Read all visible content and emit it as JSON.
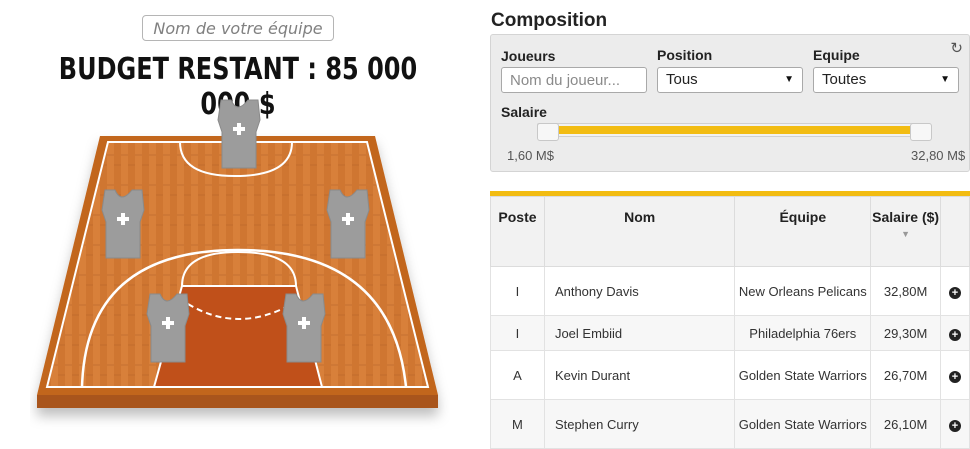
{
  "left": {
    "team_input_placeholder": "Nom de votre équipe",
    "budget_text": "BUDGET RESTANT : 85 000 000 $",
    "court_colors": {
      "wood": "#d8803a",
      "border": "#b6581a",
      "paint": "#c0501a",
      "lines": "#ffffff"
    },
    "jersey_icon": "jersey-icon"
  },
  "composition": {
    "title": "Composition",
    "joueurs_label": "Joueurs",
    "joueurs_placeholder": "Nom du joueur...",
    "position_label": "Position",
    "position_value": "Tous",
    "equipe_label": "Equipe",
    "equipe_value": "Toutes",
    "salaire_label": "Salaire",
    "min_label": "1,60 M$",
    "max_label": "32,80 M$",
    "accent": "#f2bc12"
  },
  "table": {
    "headers": {
      "poste": "Poste",
      "nom": "Nom",
      "equipe": "Équipe",
      "salaire": "Salaire ($)"
    },
    "rows": [
      {
        "poste": "I",
        "nom": "Anthony Davis",
        "equipe": "New Orleans Pelicans",
        "salaire": "32,80M"
      },
      {
        "poste": "I",
        "nom": "Joel Embiid",
        "equipe": "Philadelphia 76ers",
        "salaire": "29,30M"
      },
      {
        "poste": "A",
        "nom": "Kevin Durant",
        "equipe": "Golden State Warriors",
        "salaire": "26,70M"
      },
      {
        "poste": "M",
        "nom": "Stephen Curry",
        "equipe": "Golden State Warriors",
        "salaire": "26,10M"
      }
    ]
  }
}
